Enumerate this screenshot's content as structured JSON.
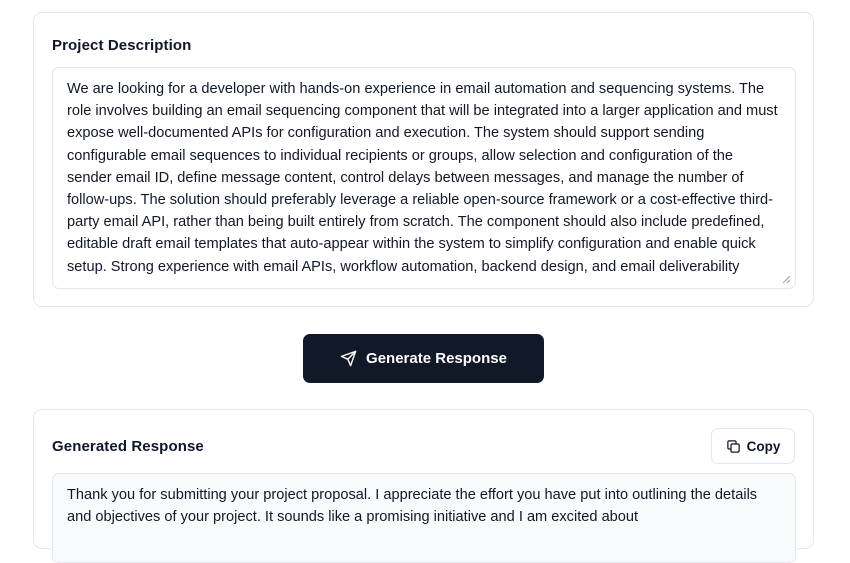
{
  "project_card": {
    "title": "Project Description",
    "description": "We are looking for a developer with hands-on experience in email automation and sequencing systems. The role involves building an email sequencing component that will be integrated into a larger application and must expose well-documented APIs for configuration and execution. The system should support sending configurable email sequences to individual recipients or groups, allow selection and configuration of the sender email ID, define message content, control delays between messages, and manage the number of follow-ups. The solution should preferably leverage a reliable open-source framework or a cost-effective third-party email API, rather than being built entirely from scratch. The component should also include predefined, editable draft email templates that auto-appear within the system to simplify configuration and enable quick setup. Strong experience with email APIs, workflow automation, backend design, and email deliverability"
  },
  "actions": {
    "generate_label": "Generate Response"
  },
  "response_card": {
    "title": "Generated Response",
    "copy_label": "Copy",
    "response": "Thank you for submitting your project proposal. I appreciate the effort you have put into outlining the details and objectives of your project. It sounds like a promising initiative and I am excited about"
  },
  "icons": {
    "generate": "send-icon",
    "copy": "copy-icon"
  },
  "colors": {
    "primary_button": "#111827",
    "border": "#e5e7eb",
    "response_bg": "#f8fafc"
  }
}
